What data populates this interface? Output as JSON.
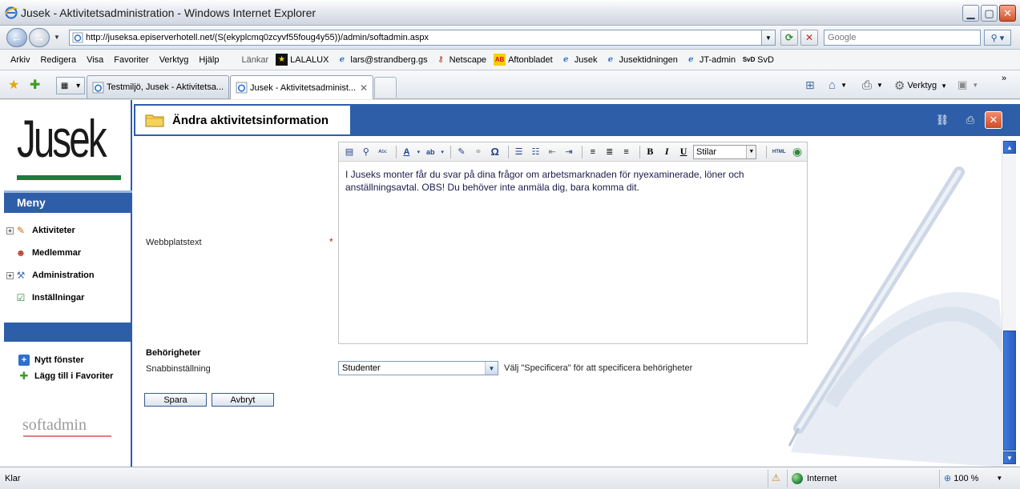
{
  "window": {
    "title": "Jusek - Aktivitetsadministration - Windows Internet Explorer"
  },
  "address": {
    "url": "http://juseksa.episerverhotell.net/(S(ekyplcmq0zcyvf55foug4y55))/admin/softadmin.aspx",
    "search_placeholder": "Google"
  },
  "menu": [
    "Arkiv",
    "Redigera",
    "Visa",
    "Favoriter",
    "Verktyg",
    "Hjälp"
  ],
  "links_label": "Länkar",
  "links": [
    {
      "label": "LALALUX",
      "icon": "lalalux-icon"
    },
    {
      "label": "lars@strandberg.gs",
      "icon": "ie-page-icon"
    },
    {
      "label": "Netscape",
      "icon": "key-icon"
    },
    {
      "label": "Aftonbladet",
      "icon": "aftonbladet-icon"
    },
    {
      "label": "Jusek",
      "icon": "ie-page-icon"
    },
    {
      "label": "Jusektidningen",
      "icon": "ie-page-icon"
    },
    {
      "label": "JT-admin",
      "icon": "ie-page-icon"
    },
    {
      "label": "SvD",
      "icon": "svd-icon"
    }
  ],
  "tabs": [
    {
      "label": "Testmiljö, Jusek - Aktivitetsa...",
      "active": false
    },
    {
      "label": "Jusek - Aktivitetsadminist...",
      "active": true
    }
  ],
  "commandbar": {
    "tools_label": "Verktyg"
  },
  "sidebar": {
    "logo_text": "Jusek",
    "menu_title": "Meny",
    "items": [
      {
        "label": "Aktiviteter",
        "expandable": true
      },
      {
        "label": "Medlemmar",
        "expandable": false
      },
      {
        "label": "Administration",
        "expandable": true
      },
      {
        "label": "Inställningar",
        "expandable": false
      }
    ],
    "new_window": "Nytt fönster",
    "add_favorites": "Lägg till i Favoriter",
    "brand": "softadmin"
  },
  "main": {
    "title": "Ändra aktivitetsinformation",
    "editor": {
      "style_placeholder": "Stilar",
      "html_label": "HTML",
      "body_text": "I Juseks monter får du svar på dina frågor om arbetsmarknaden för nyexaminerade, löner och anställningsavtal. OBS! Du behöver inte anmäla dig, bara komma dit."
    },
    "webbplatstext_label": "Webbplatstext",
    "required_mark": "*",
    "permissions_title": "Behörigheter",
    "quick_setting_label": "Snabbinställning",
    "quick_setting_value": "Studenter",
    "quick_setting_hint": "Välj \"Specificera\" för att specificera behörigheter",
    "save_label": "Spara",
    "cancel_label": "Avbryt"
  },
  "status": {
    "text": "Klar",
    "zone": "Internet",
    "zoom": "100 %"
  },
  "colors": {
    "brand_blue": "#2e5ea8",
    "logo_green": "#1e7a3d"
  }
}
